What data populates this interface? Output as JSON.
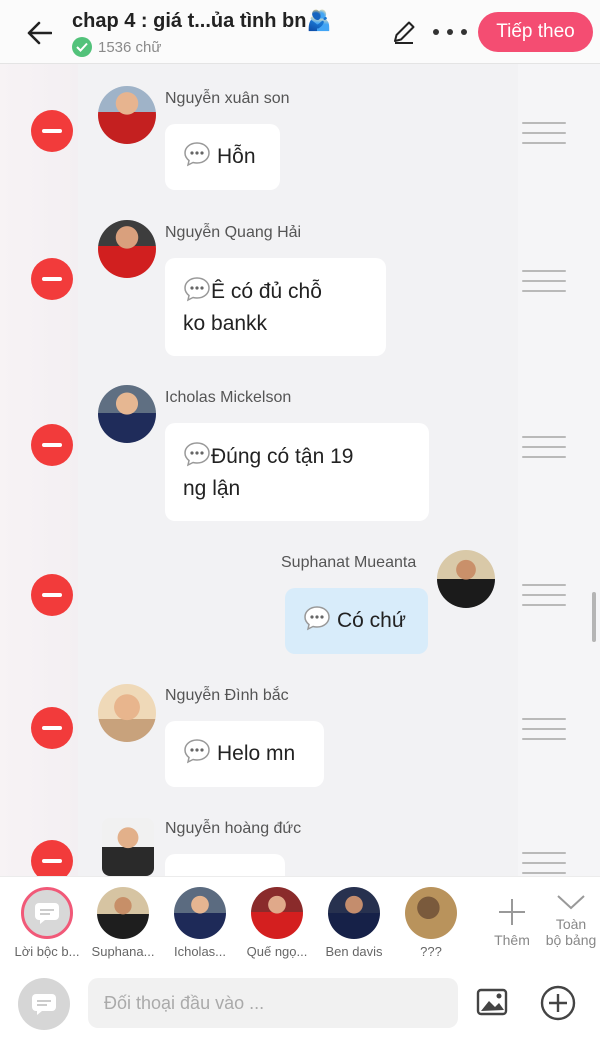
{
  "header": {
    "title": "chap 4 : giá t...ủa tình bn🫂",
    "word_count": "1536 chữ",
    "next_label": "Tiếp theo"
  },
  "messages": [
    {
      "name": "Nguyễn xuân son",
      "text": "Hỗn",
      "side": "left"
    },
    {
      "name": "Nguyễn Quang Hải",
      "text_lines": [
        "Ê có đủ chỗ",
        "ko bankk"
      ],
      "side": "left"
    },
    {
      "name": "Icholas Mickelson",
      "text_lines": [
        "Đúng có tận 19",
        "ng lận"
      ],
      "side": "left"
    },
    {
      "name": "Suphanat Mueanta",
      "text": "Có chứ",
      "side": "right"
    },
    {
      "name": "Nguyễn Đình bắc",
      "text": "Helo mn",
      "side": "left"
    },
    {
      "name": "Nguyễn hoàng đức",
      "text": "",
      "side": "left"
    }
  ],
  "characters": [
    {
      "label": "Lời bộc b...",
      "icon": "narration-icon"
    },
    {
      "label": "Suphana..."
    },
    {
      "label": "Icholas..."
    },
    {
      "label": "Quế ngọ..."
    },
    {
      "label": "Ben davis"
    },
    {
      "label": "???"
    }
  ],
  "char_actions": {
    "add_label": "Thêm",
    "all_label_1": "Toàn",
    "all_label_2": "bộ bảng"
  },
  "input": {
    "placeholder": "Đối thoại đầu vào ..."
  },
  "colors": {
    "accent": "#f44d72",
    "remove": "#f23b3b",
    "my_bubble": "#d8ecfa"
  }
}
